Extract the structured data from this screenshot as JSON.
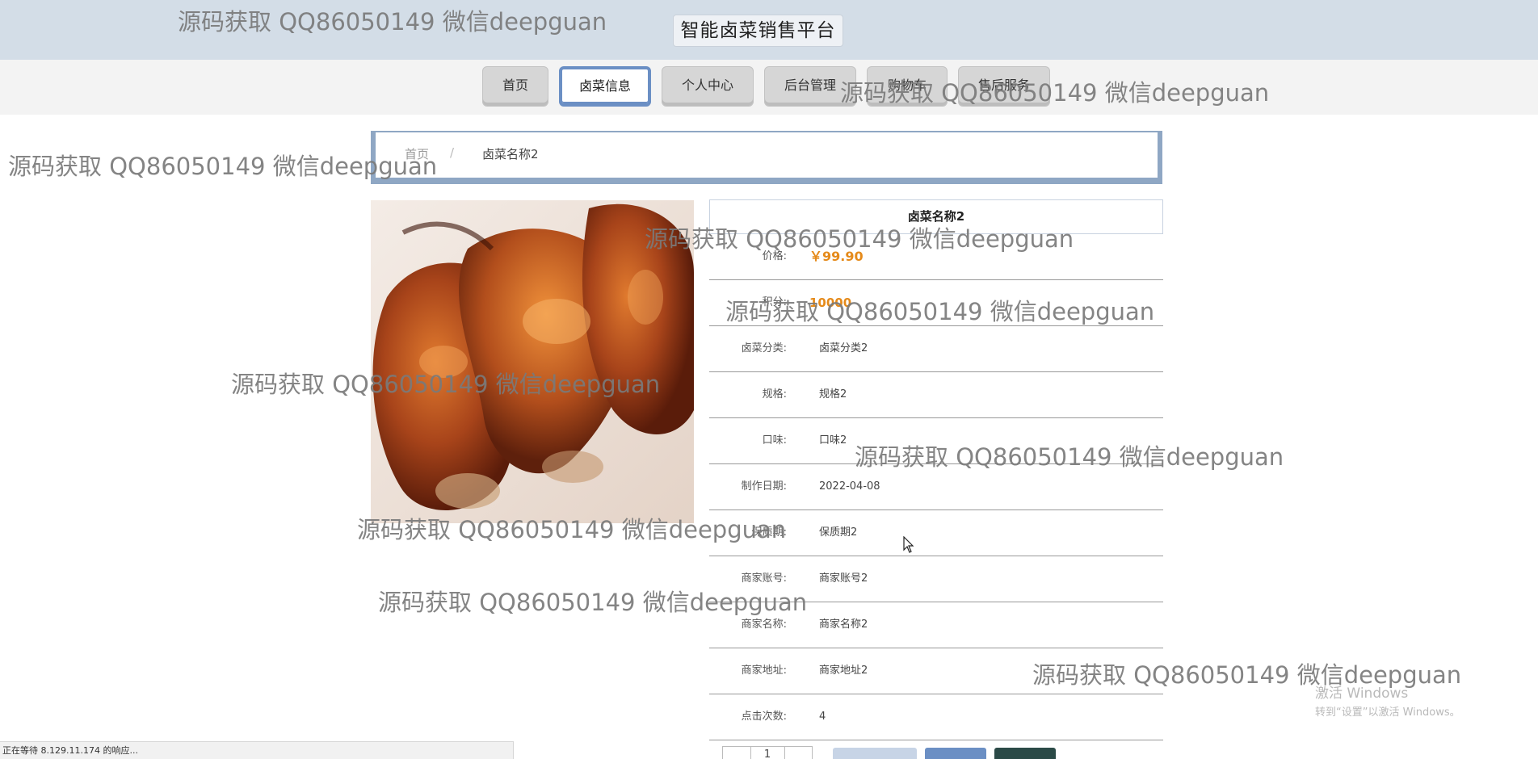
{
  "header": {
    "site_title": "智能卤菜销售平台"
  },
  "nav": [
    {
      "label": "首页"
    },
    {
      "label": "卤菜信息"
    },
    {
      "label": "个人中心"
    },
    {
      "label": "后台管理"
    },
    {
      "label": "购物车"
    },
    {
      "label": "售后服务"
    }
  ],
  "breadcrumb": {
    "home": "首页",
    "separator": "/",
    "current": "卤菜名称2"
  },
  "product": {
    "title": "卤菜名称2",
    "fields": [
      {
        "label": "价格:",
        "value": "￥99.90"
      },
      {
        "label": "积分:",
        "value": "10000"
      },
      {
        "label": "卤菜分类:",
        "value": "卤菜分类2"
      },
      {
        "label": "规格:",
        "value": "规格2"
      },
      {
        "label": "口味:",
        "value": "口味2"
      },
      {
        "label": "制作日期:",
        "value": "2022-04-08"
      },
      {
        "label": "保质期:",
        "value": "保质期2"
      },
      {
        "label": "商家账号:",
        "value": "商家账号2"
      },
      {
        "label": "商家名称:",
        "value": "商家名称2"
      },
      {
        "label": "商家地址:",
        "value": "商家地址2"
      },
      {
        "label": "点击次数:",
        "value": "4"
      }
    ],
    "quantity": "1"
  },
  "statusbar": {
    "text": "正在等待 8.129.11.174 的响应..."
  },
  "windows_activation": {
    "line1": "激活 Windows",
    "line2": "转到“设置”以激活 Windows。"
  },
  "watermark": {
    "text": "源码获取 QQ86050149 微信deepguan"
  },
  "colors": {
    "nav_active_border": "#6b8fc4",
    "price": "#e58a1a",
    "header_bg": "#d3dde7"
  }
}
